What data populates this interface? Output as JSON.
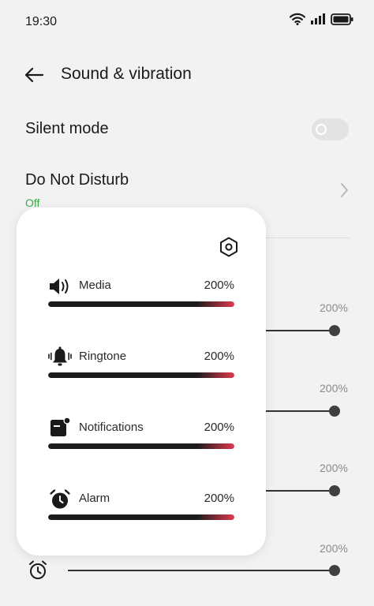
{
  "status_bar": {
    "time": "19:30"
  },
  "header": {
    "title": "Sound & vibration"
  },
  "silent_mode": {
    "label": "Silent mode",
    "enabled": false
  },
  "do_not_disturb": {
    "label": "Do Not Disturb",
    "status": "Off"
  },
  "background_sliders": [
    {
      "percent": "200%",
      "level": 1.0
    },
    {
      "percent": "200%",
      "level": 1.0
    },
    {
      "percent": "200%",
      "level": 1.0
    },
    {
      "percent": "200%",
      "level": 1.0
    }
  ],
  "volume_panel": {
    "rows": [
      {
        "label": "Media",
        "percent": "200%",
        "level": 1.0,
        "icon": "speaker-icon"
      },
      {
        "label": "Ringtone",
        "percent": "200%",
        "level": 1.0,
        "icon": "bell-vibrate-icon"
      },
      {
        "label": "Notifications",
        "percent": "200%",
        "level": 1.0,
        "icon": "notification-icon"
      },
      {
        "label": "Alarm",
        "percent": "200%",
        "level": 1.0,
        "icon": "alarm-clock-icon"
      }
    ]
  },
  "colors": {
    "accent_red": "#e0394f",
    "status_green": "#3aaa4a",
    "slider_dark": "#1b1b1b"
  }
}
